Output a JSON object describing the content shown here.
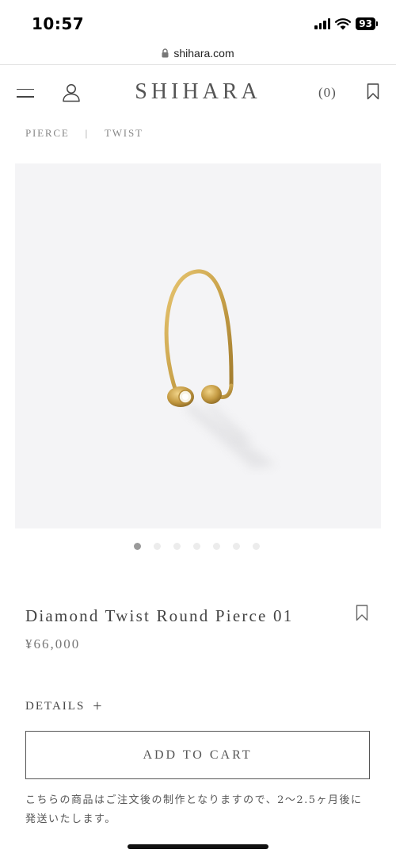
{
  "status_bar": {
    "time": "10:57",
    "battery": "93"
  },
  "browser": {
    "url": "shihara.com"
  },
  "header": {
    "logo": "SHIHARA",
    "cart_count": "(0)"
  },
  "breadcrumb": {
    "items": [
      "PIERCE",
      "TWIST"
    ],
    "separator": "|"
  },
  "carousel": {
    "total_images": 7,
    "active_index": 0
  },
  "product": {
    "title": "Diamond Twist Round Pierce 01",
    "price": "¥66,000",
    "details_label": "DETAILS",
    "add_to_cart_label": "ADD TO CART",
    "notice": "こちらの商品はご注文後の制作となりますので、2〜2.5ヶ月後に発送いたします。"
  },
  "colors": {
    "accent_gold": "#c9a24a",
    "image_bg": "#f4f4f6"
  },
  "icons": [
    "signal-icon",
    "wifi-icon",
    "battery-icon",
    "lock-icon",
    "menu-icon",
    "account-icon",
    "wishlist-icon",
    "bookmark-icon",
    "plus-icon"
  ]
}
